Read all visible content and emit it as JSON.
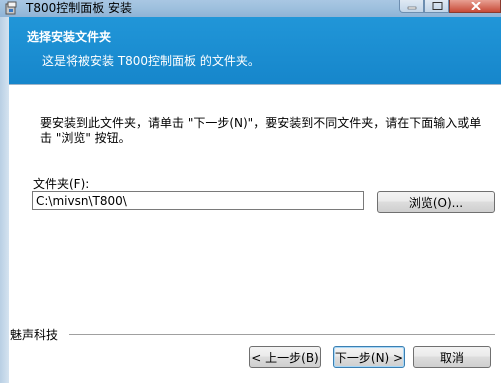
{
  "window": {
    "title": "T800控制面板 安装",
    "icon": "installer-icon"
  },
  "header": {
    "title": "选择安装文件夹",
    "subtitle": "这是将被安装 T800控制面板 的文件夹。"
  },
  "body": {
    "instruction": "要安装到此文件夹，请单击 \"下一步(N)\"，要安装到不同文件夹，请在下面输入或单击 \"浏览\" 按钮。",
    "folder_label": "文件夹(F):",
    "folder_value": "C:\\mivsn\\T800\\",
    "browse_label": "浏览(O)..."
  },
  "footer": {
    "company": "魅声科技",
    "back_label": "< 上一步(B)",
    "next_label": "下一步(N) >",
    "cancel_label": "取消"
  }
}
